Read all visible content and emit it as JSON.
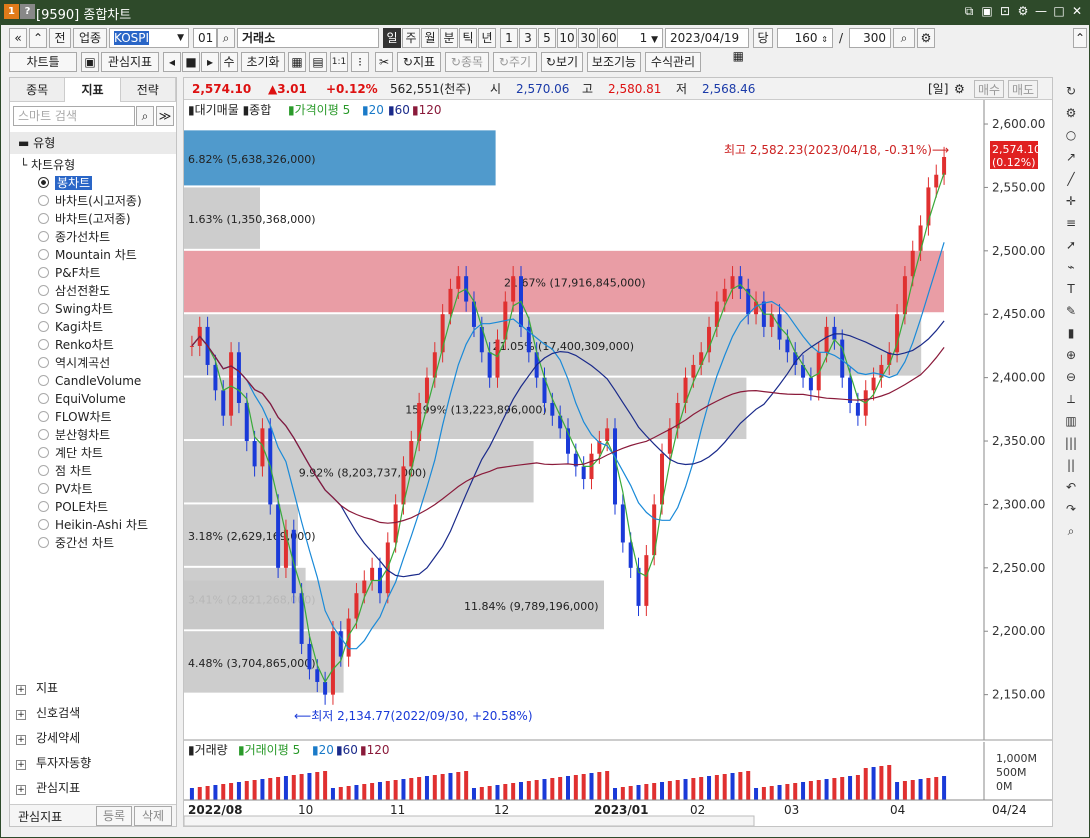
{
  "window": {
    "title": "[9590] 종합차트",
    "badge1": "1",
    "badge2": "?"
  },
  "toolbar1": {
    "nav_prev": "«",
    "nav_up": "»",
    "jeon": "전",
    "sector": "업종",
    "market": "KOSPI",
    "code": "01",
    "exchange": "거래소",
    "periods": [
      "일",
      "주",
      "월",
      "분",
      "틱",
      "년"
    ],
    "minutes": [
      "1",
      "3",
      "5",
      "10",
      "30",
      "60"
    ],
    "count": "1",
    "date": "2023/04/19",
    "dang": "당",
    "bars": "160",
    "total": "300"
  },
  "toolbar2": {
    "chart_type": "차트틀",
    "interest": "관심지표",
    "reset": "초기화",
    "indicator": "지표",
    "item": "종목",
    "cycle": "주기",
    "view": "보기",
    "aux": "보조기능",
    "formula": "수식관리"
  },
  "left": {
    "tabs": [
      "종목",
      "지표",
      "전략"
    ],
    "search_placeholder": "스마트 검색",
    "type_group": "유형",
    "chart_type_label": "차트유형",
    "items": [
      "봉차트",
      "바차트(시고저종)",
      "바차트(고저종)",
      "종가선차트",
      "Mountain 차트",
      "P&F차트",
      "삼선전환도",
      "Swing차트",
      "Kagi차트",
      "Renko차트",
      "역시계곡선",
      "CandleVolume",
      "EquiVolume",
      "FLOW차트",
      "분산형차트",
      "계단 차트",
      "점 차트",
      "PV차트",
      "POLE차트",
      "Heikin-Ashi 차트",
      "중간선 차트"
    ],
    "groups": [
      "지표",
      "신호검색",
      "강세약세",
      "투자자동향",
      "관심지표"
    ],
    "bottom_label": "관심지표",
    "register": "등록",
    "delete": "삭제"
  },
  "info": {
    "price": "2,574.10",
    "change": "▲3.01",
    "pct": "+0.12%",
    "volume": "562,551(천주)",
    "open_label": "시",
    "open": "2,570.06",
    "high_label": "고",
    "high": "2,580.81",
    "low_label": "저",
    "low": "2,568.46",
    "period": "[일]",
    "buy": "매수",
    "sell": "매도"
  },
  "legend": {
    "vp": "대기매물",
    "main": "종합",
    "ma": "가격이평",
    "ma_p": [
      "5",
      "20",
      "60",
      "120"
    ]
  },
  "vol_legend": {
    "label": "거래량",
    "ma": "거래이평",
    "ma_p": [
      "5",
      "20",
      "60",
      "120"
    ]
  },
  "annotations": {
    "max": "최고 2,582.23(2023/04/18, -0.31%)",
    "min": "최저 2,134.77(2022/09/30, +20.58%)",
    "cur": "2,574.10",
    "cur_pct": "(0.12%)"
  },
  "chart_data": {
    "type": "candlestick",
    "ylim": [
      2130,
      2615
    ],
    "yticks": [
      2150,
      2200,
      2250,
      2300,
      2350,
      2400,
      2450,
      2500,
      2550,
      2600
    ],
    "xlabels": [
      "2022/08",
      "10",
      "11",
      "12",
      "2023/01",
      "02",
      "03",
      "04",
      "04/24"
    ],
    "volume_ticks": [
      "1,000M",
      "500M",
      "0M"
    ],
    "volume_profile": [
      {
        "lo": 2550,
        "hi": 2595,
        "pct": "6.82% (5,638,326,000)",
        "ratio": 0.41
      },
      {
        "lo": 2500,
        "hi": 2550,
        "pct": "1.63% (1,350,368,000)",
        "ratio": 0.1
      },
      {
        "lo": 2450,
        "hi": 2500,
        "pct": "21.67% (17,916,845,000)",
        "ratio": 1.0
      },
      {
        "lo": 2400,
        "hi": 2450,
        "pct": "21.05% (17,400,309,000)",
        "ratio": 0.97
      },
      {
        "lo": 2350,
        "hi": 2400,
        "pct": "15.99% (13,223,896,000)",
        "ratio": 0.74
      },
      {
        "lo": 2300,
        "hi": 2350,
        "pct": "9.92% (8,203,737,000)",
        "ratio": 0.46
      },
      {
        "lo": 2250,
        "hi": 2300,
        "pct": "3.18% (2,629,169,000)",
        "ratio": 0.15
      },
      {
        "lo": 2200,
        "hi": 2250,
        "pct": "3.41% (2,821,268,000)",
        "ratio": 0.16
      },
      {
        "lo": 2200,
        "hi": 2240,
        "pct": "11.84% (9,789,196,000)",
        "ratio": 0.55
      },
      {
        "lo": 2150,
        "hi": 2200,
        "pct": "4.48% (3,704,865,000)",
        "ratio": 0.21
      }
    ],
    "close_path": [
      2425,
      2440,
      2410,
      2390,
      2370,
      2420,
      2380,
      2350,
      2330,
      2360,
      2300,
      2250,
      2280,
      2230,
      2190,
      2170,
      2160,
      2150,
      2200,
      2180,
      2210,
      2230,
      2240,
      2250,
      2230,
      2270,
      2300,
      2330,
      2350,
      2380,
      2400,
      2420,
      2450,
      2470,
      2480,
      2460,
      2440,
      2420,
      2400,
      2430,
      2460,
      2480,
      2440,
      2420,
      2400,
      2380,
      2370,
      2360,
      2340,
      2330,
      2320,
      2340,
      2350,
      2360,
      2300,
      2270,
      2250,
      2220,
      2260,
      2300,
      2340,
      2360,
      2380,
      2400,
      2410,
      2420,
      2440,
      2460,
      2470,
      2480,
      2470,
      2450,
      2460,
      2440,
      2450,
      2430,
      2420,
      2410,
      2400,
      2390,
      2420,
      2440,
      2430,
      2400,
      2380,
      2370,
      2390,
      2400,
      2410,
      2420,
      2450,
      2480,
      2500,
      2520,
      2550,
      2560,
      2574
    ]
  }
}
